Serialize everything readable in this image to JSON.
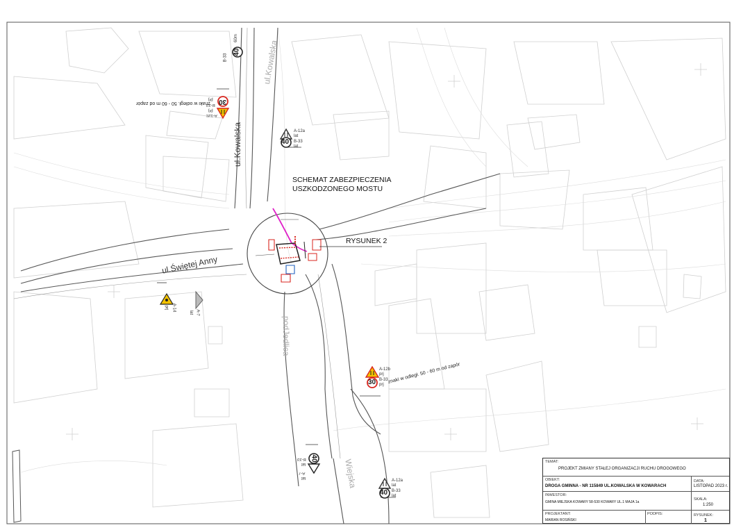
{
  "map": {
    "scheme_title_line1": "SCHEMAT ZABEZPIECZENIA",
    "scheme_title_line2": "USZKODZONEGO MOSTU",
    "figure_callout": "RYSUNEK 2",
    "streets": {
      "kowalska_vertical": "ul.Kowalska",
      "kowalska_top": "ul.Kowalska",
      "swietej_anny": "ul.Świętej Anny",
      "podjedlica": "podJedlica",
      "wiejska": "Wiejska"
    },
    "notes": {
      "distance_top": "znaki w odległ. 50 - 60 m od zapór",
      "distance_right": "znaki w odległ. 50 - 60 m od zapór",
      "distance_60m": "60m"
    },
    "signs": {
      "top_40": {
        "codes": [
          "A-12a",
          "B-33"
        ],
        "suffixes": [
          "lat",
          "lat"
        ],
        "speed": "40"
      },
      "top_left_30": {
        "codes": [
          "A-12c",
          "B-33"
        ],
        "suffixes": [
          "prj",
          "prj"
        ],
        "speed": "30"
      },
      "top_b33": {
        "code": "B-33",
        "speed": "40"
      },
      "left_a14": {
        "code": "A-14",
        "suffix": "prj"
      },
      "left_a7": {
        "code": "A-7",
        "suffix": "lat"
      },
      "right_30": {
        "codes": [
          "A-12b",
          "B-33"
        ],
        "suffixes": [
          "prj",
          "prj"
        ],
        "speed": "30"
      },
      "bottom_40": {
        "codes": [
          "B-33",
          "A-7"
        ],
        "suffixes": [
          "lat",
          "lat"
        ],
        "speed": "40"
      },
      "bottom_right_40": {
        "codes": [
          "A-12a",
          "B-33"
        ],
        "suffixes": [
          "lat",
          "lat"
        ],
        "speed": "40"
      }
    },
    "colors": {
      "base_map": "#cfcfcf",
      "road": "#555555",
      "sign_red": "#d8261f",
      "sign_yellow": "#f3c200",
      "magenta": "#e020c8",
      "blue": "#2060c0"
    }
  },
  "title_block": {
    "temat_caption": "TEMAT:",
    "temat": "PROJEKT ZMIANY STAŁEJ ORGANIZACJI RUCHU DROGOWEGO",
    "obiekt_caption": "OBIEKT:",
    "obiekt": "DROGA GMINNA - NR 115849 UL.KOWALSKA W KOWARACH",
    "data_caption": "DATA:",
    "data": "LISTOPAD 2023 r.",
    "inwestor_caption": "INWESTOR:",
    "inwestor": "GMINA MIEJSKA KOWARY 58-530 KOWARY UL.1 MAJA 1a",
    "skala_caption": "SKALA:",
    "skala": "1:250",
    "projektant_caption": "PROJEKTANT:",
    "projektant": "MARIAN ROSIŃSKI",
    "podpis_caption": "PODPIS:",
    "rysunek_caption": "RYSUNEK:",
    "rysunek": "1"
  }
}
